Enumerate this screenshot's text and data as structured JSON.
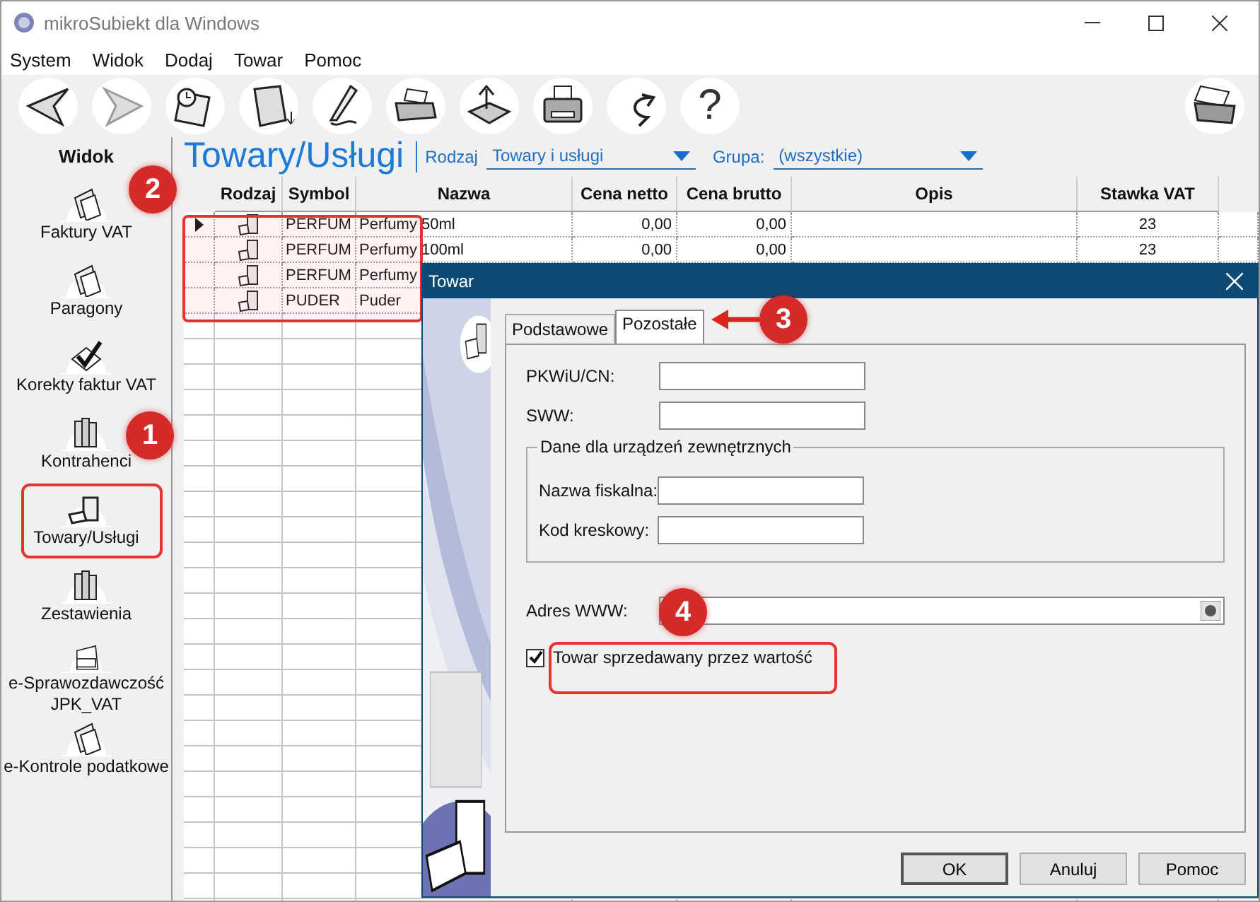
{
  "window": {
    "title": "mikroSubiekt dla Windows"
  },
  "menu": [
    "System",
    "Widok",
    "Dodaj",
    "Towar",
    "Pomoc"
  ],
  "toolbar": {
    "help_glyph": "?"
  },
  "sidebar": {
    "title": "Widok",
    "items": [
      {
        "label": "Faktury VAT"
      },
      {
        "label": "Paragony"
      },
      {
        "label": "Korekty faktur VAT"
      },
      {
        "label": "Kontrahenci"
      },
      {
        "label": "Towary/Usługi"
      },
      {
        "label": "Zestawienia"
      },
      {
        "label": "e-Sprawozdawczość\nJPK_VAT"
      },
      {
        "label": "e-Kontrole podatkowe"
      }
    ]
  },
  "view": {
    "title": "Towary/Usługi",
    "filters": [
      {
        "label": "Rodzaj",
        "value": "Towary i usługi"
      },
      {
        "label": "Grupa:",
        "value": "(wszystkie)"
      }
    ]
  },
  "table": {
    "columns": [
      "Rodzaj",
      "Symbol",
      "Nazwa",
      "Cena netto",
      "Cena brutto",
      "Opis",
      "Stawka VAT"
    ],
    "rows": [
      {
        "selected": true,
        "symbol": "PERFUM",
        "name": "Perfumy 50ml",
        "net": "0,00",
        "gross": "0,00",
        "vat": "23"
      },
      {
        "selected": false,
        "symbol": "PERFUM",
        "name": "Perfumy 100ml",
        "net": "0,00",
        "gross": "0,00",
        "vat": "23"
      },
      {
        "selected": false,
        "symbol": "PERFUM",
        "name": "Perfumy"
      },
      {
        "selected": false,
        "symbol": "PUDER",
        "name": "Puder"
      }
    ]
  },
  "dialog": {
    "title": "Towar",
    "tabs": [
      {
        "label": "Podstawowe",
        "selected": false
      },
      {
        "label": "Pozostałe",
        "selected": true
      }
    ],
    "fields": [
      {
        "label": "PKWiU/CN:"
      },
      {
        "label": "SWW:"
      }
    ],
    "group": {
      "title": "Dane dla urządzeń zewnętrznych",
      "fields": [
        {
          "label": "Nazwa fiskalna:"
        },
        {
          "label": "Kod kreskowy:"
        }
      ]
    },
    "url_field": {
      "label": "Adres WWW:"
    },
    "checkbox": {
      "label": "Towar sprzedawany przez wartość",
      "checked": true
    },
    "buttons": [
      "OK",
      "Anuluj",
      "Pomoc"
    ]
  },
  "annotations": [
    "1",
    "2",
    "3",
    "4"
  ]
}
